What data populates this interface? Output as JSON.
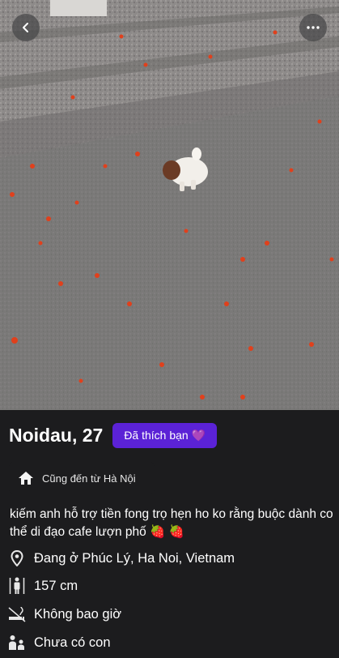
{
  "profile": {
    "name_age": "Noidau, 27",
    "liked_badge": "Đã thích bạn 💜",
    "origin": "Cũng đến từ Hà Nội",
    "bio": "kiếm anh hỗ trợ tiền fong trọ hẹn ho ko rằng buộc dành co thể di đạo cafe lượn phố 🍓 🍓",
    "details": [
      {
        "icon": "location-pin-icon",
        "text": "Đang ở Phúc Lý, Ha Noi, Vietnam"
      },
      {
        "icon": "height-icon",
        "text": "157 cm"
      },
      {
        "icon": "smoking-icon",
        "text": "Không bao giờ"
      },
      {
        "icon": "baby-icon",
        "text": "Chưa có con"
      }
    ]
  },
  "icons": {
    "back": "chevron-left-icon",
    "more": "more-dots-icon",
    "origin": "home-icon"
  },
  "colors": {
    "background": "#1c1c1e",
    "badge": "#5b22d6"
  }
}
